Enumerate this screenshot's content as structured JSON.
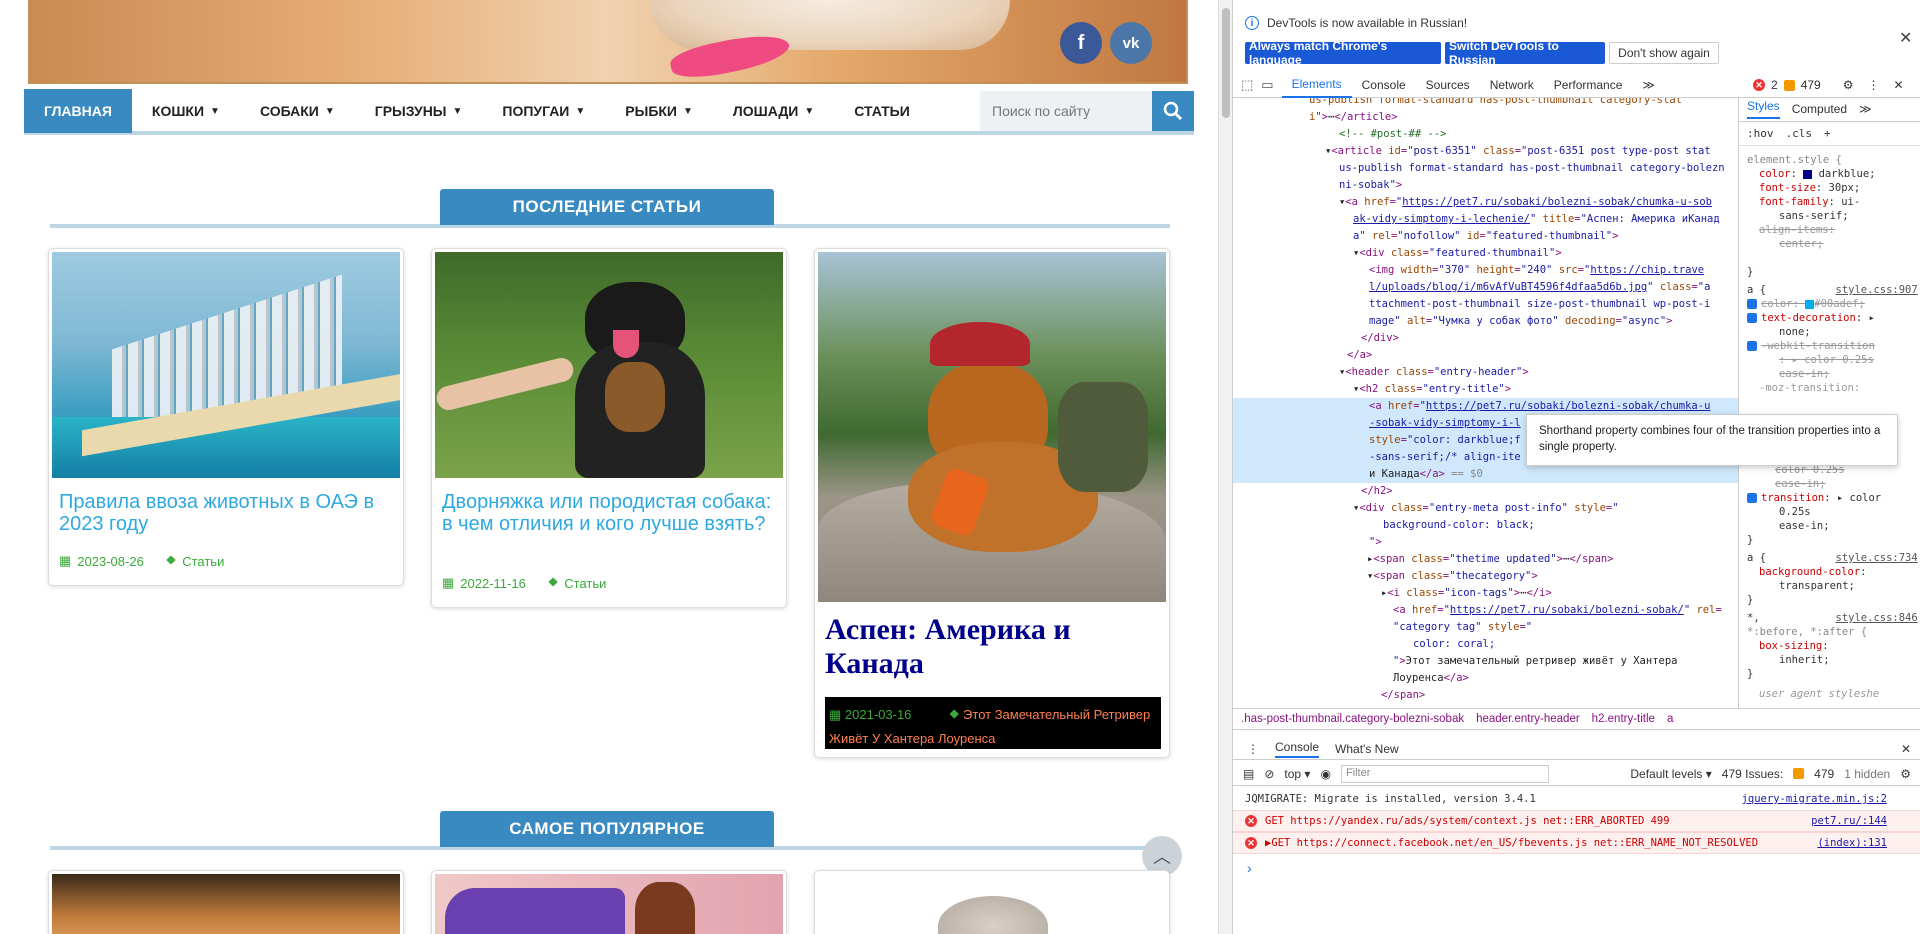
{
  "site": {
    "social": {
      "facebook": "f",
      "vk": "vk"
    },
    "nav": [
      {
        "label": "ГЛАВНАЯ",
        "active": true,
        "caret": false
      },
      {
        "label": "КОШКИ",
        "active": false,
        "caret": true
      },
      {
        "label": "СОБАКИ",
        "active": false,
        "caret": true
      },
      {
        "label": "ГРЫЗУНЫ",
        "active": false,
        "caret": true
      },
      {
        "label": "ПОПУГАИ",
        "active": false,
        "caret": true
      },
      {
        "label": "РЫБКИ",
        "active": false,
        "caret": true
      },
      {
        "label": "ЛОШАДИ",
        "active": false,
        "caret": true
      },
      {
        "label": "СТАТЬИ",
        "active": false,
        "caret": false
      }
    ],
    "search_placeholder": "Поиск по сайту",
    "latest_title": "ПОСЛЕДНИЕ СТАТЬИ",
    "popular_title": "САМОЕ ПОПУЛЯРНОЕ",
    "cards": [
      {
        "title": "Правила ввоза животных в ОАЭ в 2023 году",
        "date": "2023-08-26",
        "category": "Статьи"
      },
      {
        "title": "Дворняжка или породистая собака: в чем отличия и кого лучше взять?",
        "date": "2022-11-16",
        "category": "Статьи"
      },
      {
        "title": "Аспен: Америка и Канада",
        "date": "2021-03-16",
        "category": "Этот Замечательный Ретривер Живёт У Хантера Лоуренса"
      }
    ],
    "colors": {
      "accent": "#3a8ac2",
      "link": "#2ea8e0",
      "meta": "#3aaa3a",
      "coral": "#ff7f50",
      "darkblue": "#00008b"
    }
  },
  "devtools": {
    "banner": "DevTools is now available in Russian!",
    "btn_match": "Always match Chrome's language",
    "btn_switch": "Switch DevTools to Russian",
    "btn_dont": "Don't show again",
    "tabs": [
      "Elements",
      "Console",
      "Sources",
      "Network",
      "Performance"
    ],
    "more": "≫",
    "errors": "2",
    "warnings": "479",
    "styles_tabs": [
      "Styles",
      "Computed"
    ],
    "styles_more": "≫",
    "hov": ":hov",
    "cls": ".cls",
    "tooltip": "Shorthand property combines four of the transition properties into a single property.",
    "crumbs": [
      ".has-post-thumbnail.category-bolezni-sobak",
      "header.entry-header",
      "h2.entry-title",
      "a"
    ],
    "console_tabs": [
      "Console",
      "What's New"
    ],
    "context": "top",
    "filter": "Filter",
    "levels": "Default levels",
    "issues": "479 Issues:",
    "issues_count": "479",
    "hidden": "1 hidden",
    "logs": [
      {
        "type": "info",
        "text": "JQMIGRATE: Migrate is installed, version 3.4.1",
        "src": "jquery-migrate.min.js:2"
      },
      {
        "type": "err",
        "text": "GET https://yandex.ru/ads/system/context.js net::ERR_ABORTED 499",
        "src": "pet7.ru/:144"
      },
      {
        "type": "err",
        "text": "▶GET https://connect.facebook.net/en_US/fbevents.js net::ERR_NAME_NOT_RESOLVED",
        "src": "(index):131"
      }
    ],
    "prompt": "›"
  }
}
